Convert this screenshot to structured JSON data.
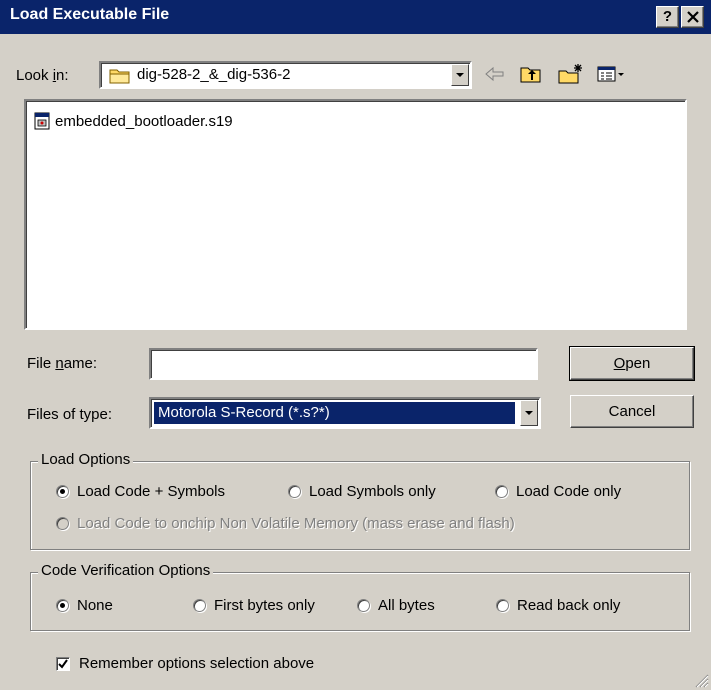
{
  "window": {
    "title": "Load Executable File",
    "help_button": "?",
    "close_button": "×"
  },
  "lookin": {
    "label_prefix": "Look ",
    "label_mnemonic": "i",
    "label_suffix": "n:",
    "folder": "dig-528-2_&_dig-536-2",
    "toolbar_icons": [
      "back-arrow-icon",
      "up-folder-icon",
      "new-folder-icon",
      "view-menu-icon"
    ]
  },
  "files": [
    {
      "name": "embedded_bootloader.s19",
      "icon": "s-record-file-icon"
    }
  ],
  "filename": {
    "label_prefix": "File ",
    "label_mnemonic": "n",
    "label_suffix": "ame:",
    "value": ""
  },
  "filetype": {
    "label": "Files of type:",
    "selected": "Motorola S-Record (*.s?*)"
  },
  "buttons": {
    "open_mnemonic": "O",
    "open_rest": "pen",
    "cancel": "Cancel"
  },
  "load_options": {
    "title": "Load Options",
    "options": [
      {
        "label": "Load Code + Symbols",
        "checked": true,
        "enabled": true
      },
      {
        "label": "Load Symbols only",
        "checked": false,
        "enabled": true
      },
      {
        "label": "Load Code only",
        "checked": false,
        "enabled": true
      },
      {
        "label": "Load Code to onchip Non Volatile Memory (mass erase and flash)",
        "checked": false,
        "enabled": false
      }
    ]
  },
  "verification": {
    "title": "Code Verification Options",
    "options": [
      {
        "label": "None",
        "checked": true
      },
      {
        "label": "First bytes only",
        "checked": false
      },
      {
        "label": "All bytes",
        "checked": false
      },
      {
        "label": "Read back only",
        "checked": false
      }
    ]
  },
  "remember": {
    "label": "Remember options selection above",
    "checked": true
  },
  "colors": {
    "titlebar": "#0a246a",
    "selection": "#0a246a",
    "face": "#d4d0c8"
  }
}
